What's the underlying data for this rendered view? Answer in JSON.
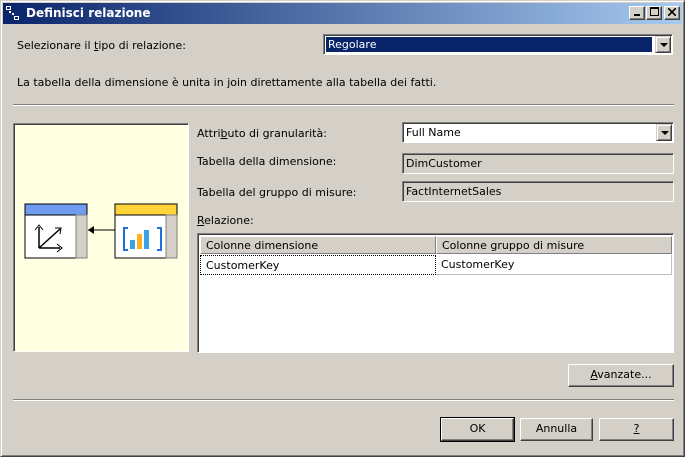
{
  "window": {
    "title": "Definisci relazione"
  },
  "relation_type": {
    "label_pre": "Selezionare il ",
    "label_acc": "t",
    "label_post": "ipo di relazione:",
    "value": "Regolare"
  },
  "description": "La tabella della dimensione è unita in join direttamente alla tabella dei fatti.",
  "granularity": {
    "label_pre": "Attri",
    "label_acc": "b",
    "label_post": "uto di granularità:",
    "value": "Full Name"
  },
  "dimension_table": {
    "label": "Tabella della dimensione:",
    "value": "DimCustomer"
  },
  "measure_group_table": {
    "label": "Tabella del gruppo di misure:",
    "value": "FactInternetSales"
  },
  "relation": {
    "label_acc": "R",
    "label_post": "elazione:"
  },
  "grid": {
    "headers": [
      "Colonne dimensione",
      "Colonne gruppo di misure"
    ],
    "rows": [
      [
        "CustomerKey",
        "CustomerKey"
      ]
    ]
  },
  "buttons": {
    "advanced_acc": "A",
    "advanced_post": "vanzate...",
    "ok": "OK",
    "cancel": "Annulla",
    "help": "?"
  },
  "colors": {
    "titlebar_start": "#0a246a",
    "titlebar_end": "#a6caf0",
    "diagram_bg": "#ffffe1",
    "dim_header": "#6f9cf0",
    "fact_header": "#ffd43a"
  },
  "icons": {
    "app": "relation-app-icon",
    "minimize": "minimize-icon",
    "maximize": "maximize-icon",
    "close": "close-icon",
    "dropdown": "chevron-down-icon",
    "dimension": "dimension-axes-icon",
    "fact": "fact-bar-chart-icon",
    "arrow": "arrow-left-icon"
  }
}
